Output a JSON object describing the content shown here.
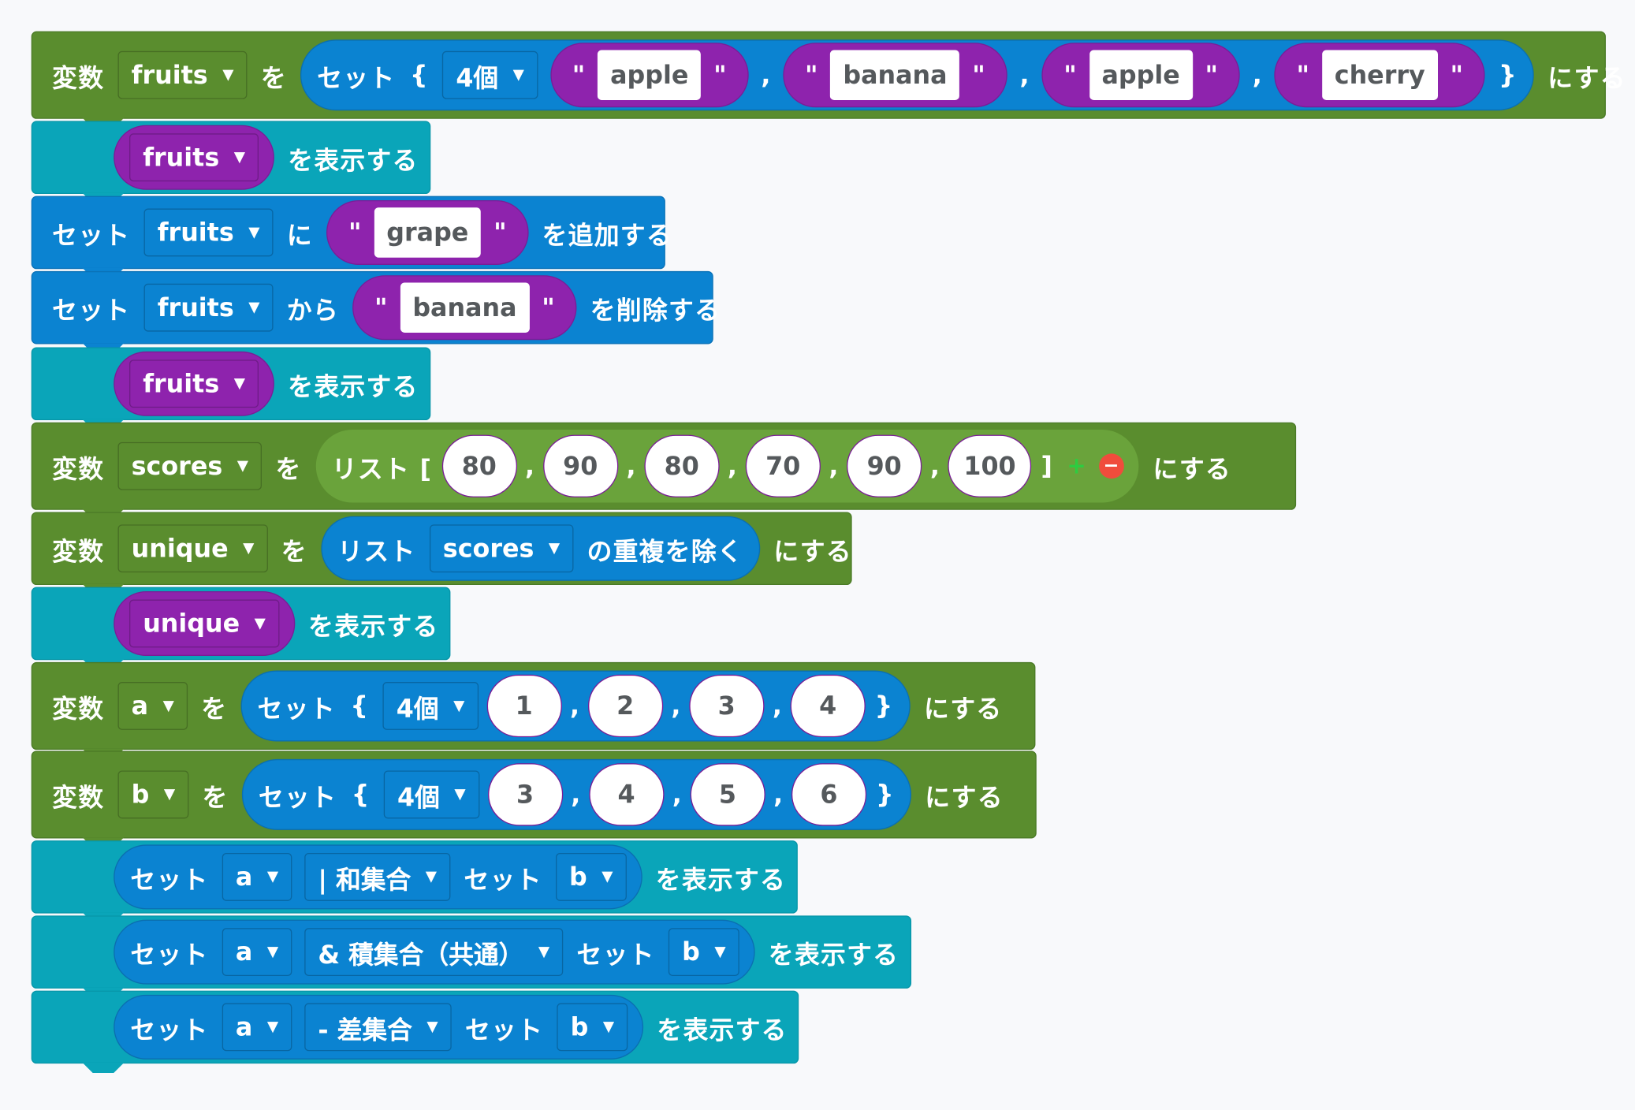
{
  "words": {
    "hensu": "変数",
    "wo": "を",
    "ni_suru": "にする",
    "set": "セット",
    "hyoji": "を表示する",
    "ni": "に",
    "tsuika": "を追加する",
    "kara": "から",
    "sakujo": "を削除する",
    "list_open": "リスト [",
    "list_close": "]",
    "list": "リスト",
    "dedupe": "の重複を除く",
    "brace_open": "{",
    "brace_close": "}",
    "quote": "\"",
    "comma": ",",
    "plus": "+",
    "minus": "−"
  },
  "rows": {
    "r1": {
      "var": "fruits",
      "count": "4個",
      "items": [
        "apple",
        "banana",
        "apple",
        "cherry"
      ]
    },
    "r2": {
      "var": "fruits"
    },
    "r3": {
      "var": "fruits",
      "item": "grape"
    },
    "r4": {
      "var": "fruits",
      "item": "banana"
    },
    "r5": {
      "var": "fruits"
    },
    "r6": {
      "var": "scores",
      "items": [
        "80",
        "90",
        "80",
        "70",
        "90",
        "100"
      ]
    },
    "r7": {
      "var": "unique",
      "src": "scores"
    },
    "r8": {
      "var": "unique"
    },
    "r9": {
      "var": "a",
      "count": "4個",
      "items": [
        "1",
        "2",
        "3",
        "4"
      ]
    },
    "r10": {
      "var": "b",
      "count": "4個",
      "items": [
        "3",
        "4",
        "5",
        "6"
      ]
    },
    "r11": {
      "a": "a",
      "op": "| 和集合",
      "b": "b"
    },
    "r12": {
      "a": "a",
      "op": "& 積集合（共通）",
      "b": "b"
    },
    "r13": {
      "a": "a",
      "op": "- 差集合",
      "b": "b"
    }
  },
  "icons": {
    "dropdown": "chevron-down-icon"
  },
  "colors": {
    "variable_block": "#5a8d2e",
    "print_block": "#0aa5b9",
    "set_block": "#0b83d1",
    "text_block": "#8e23ad",
    "list_block": "#6aa33b"
  }
}
